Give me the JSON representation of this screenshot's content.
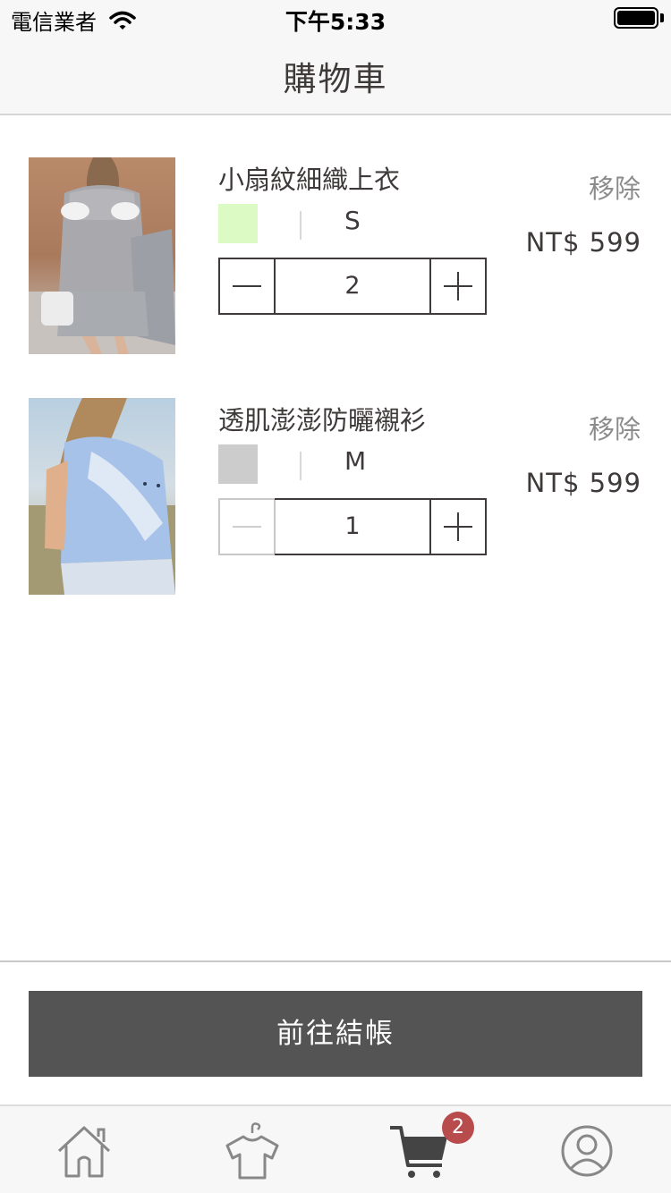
{
  "status_bar": {
    "carrier": "電信業者",
    "time": "下午5:33"
  },
  "nav": {
    "title": "購物車"
  },
  "cart": {
    "items": [
      {
        "name": "小扇紋細織上衣",
        "color": "#dcfbc4",
        "size": "S",
        "quantity": "2",
        "remove_label": "移除",
        "price": "NT$ 599",
        "minus_enabled": true
      },
      {
        "name": "透肌澎澎防曬襯衫",
        "color": "#cccccc",
        "size": "M",
        "quantity": "1",
        "remove_label": "移除",
        "price": "NT$ 599",
        "minus_enabled": false
      }
    ]
  },
  "footer": {
    "checkout_label": "前往結帳"
  },
  "tab_bar": {
    "tabs": [
      {
        "icon": "home-icon"
      },
      {
        "icon": "shirt-icon"
      },
      {
        "icon": "cart-icon"
      },
      {
        "icon": "profile-icon"
      }
    ],
    "cart_badge": "2"
  },
  "colors": {
    "text": "#3f3a3a",
    "checkout_button": "#545454",
    "badge": "#b84b4b"
  }
}
